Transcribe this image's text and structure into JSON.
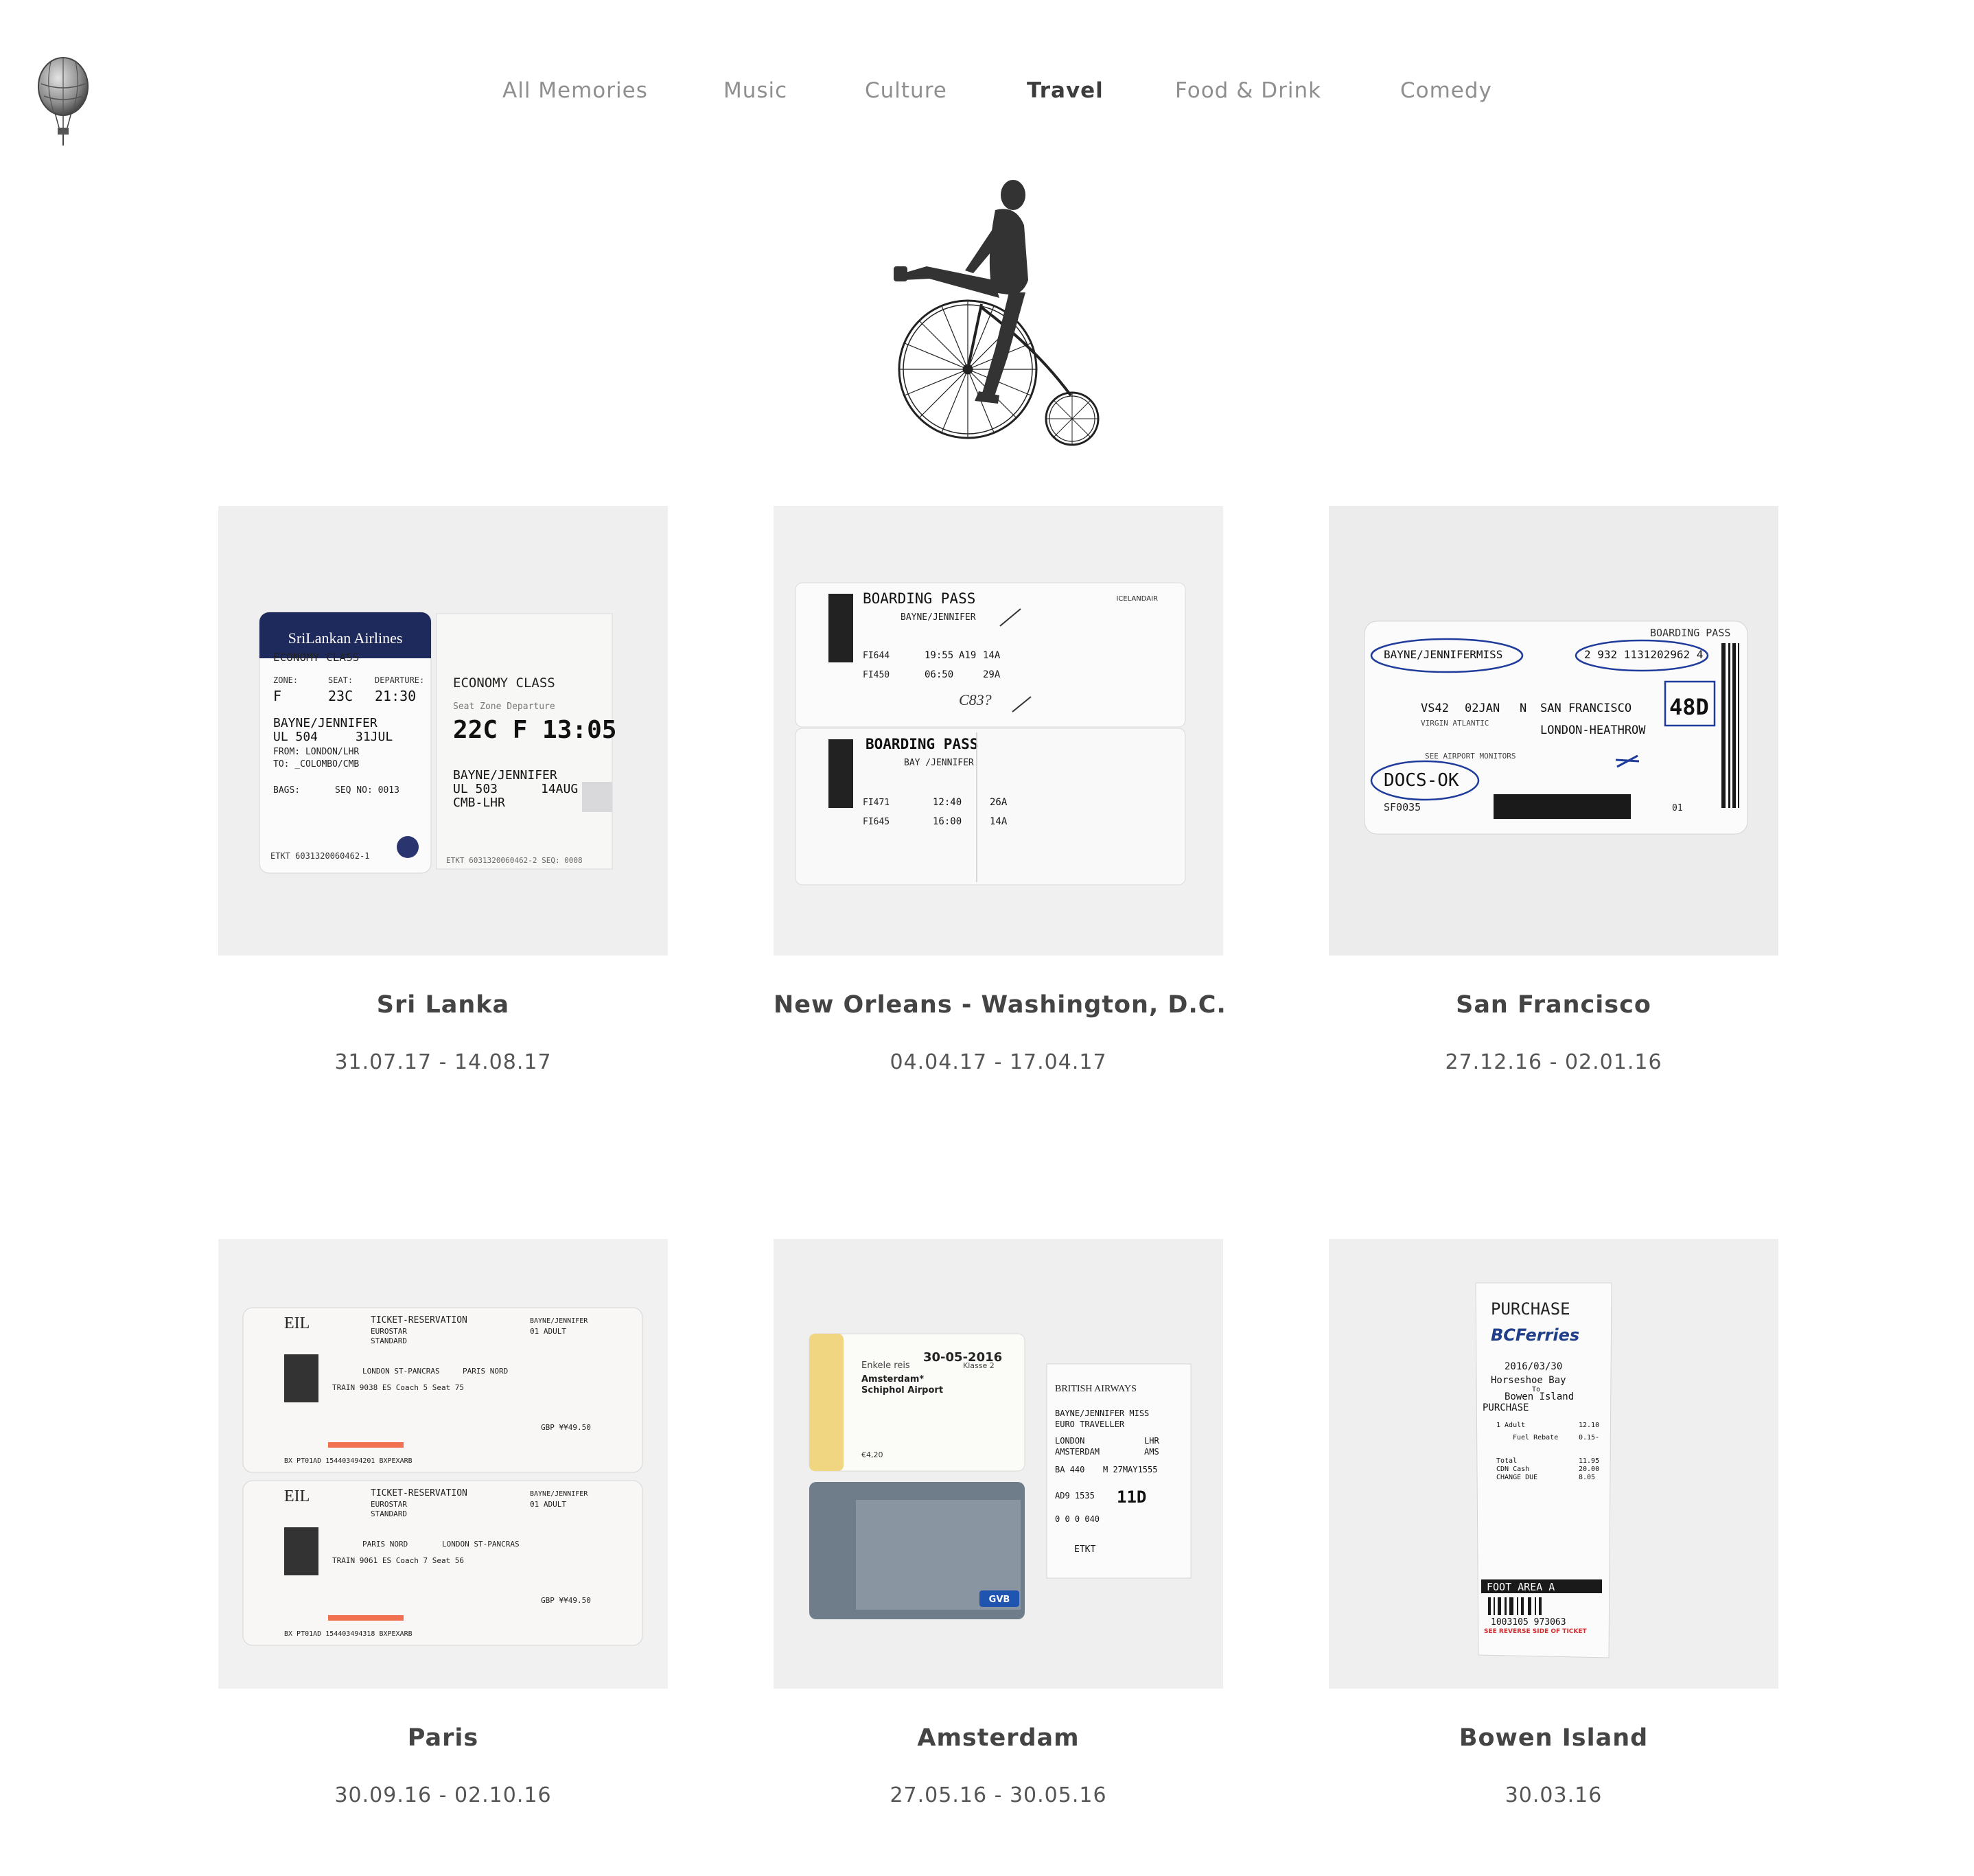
{
  "nav": {
    "items": [
      {
        "label": "All Memories",
        "active": false
      },
      {
        "label": "Music",
        "active": false
      },
      {
        "label": "Culture",
        "active": false
      },
      {
        "label": "Travel",
        "active": true
      },
      {
        "label": "Food & Drink",
        "active": false
      },
      {
        "label": "Comedy",
        "active": false
      }
    ]
  },
  "logo": {
    "icon": "hot-air-balloon-icon"
  },
  "hero": {
    "icon": "penny-farthing-rider-illustration"
  },
  "cards": [
    {
      "title": "Sri Lanka",
      "dates": "31.07.17 - 14.08.17",
      "photo": {
        "airline": "SriLankan Airlines",
        "class_left": "ECONOMY CLASS",
        "zone_lbl": "ZONE:",
        "seat_lbl": "SEAT:",
        "dep_lbl": "DEPARTURE:",
        "zone": "F",
        "seat": "23C",
        "time": "21:30",
        "name": "BAYNE/JENNIFER",
        "flight": "UL 504",
        "date": "31JUL",
        "from": "FROM:  LONDON/LHR",
        "to": "TO:  _COLOMBO/CMB",
        "bags": "BAGS:",
        "seq": "SEQ NO: 0013",
        "etkt": "ETKT 6031320060462-1",
        "class_right": "ECONOMY CLASS",
        "seat_zone_lbl": "Seat   Zone  Departure",
        "big": "22C F 13:05",
        "name2": "BAYNE/JENNIFER",
        "flight2": "UL 503",
        "date2": "14AUG",
        "route2": "CMB-LHR",
        "etkt2": "ETKT 6031320060462-2  SEQ: 0008"
      }
    },
    {
      "title": "New Orleans - Washington, D.C.",
      "dates": "04.04.17 - 17.04.17",
      "photo": {
        "heading": "BOARDING PASS",
        "airline": "ICELANDAIR",
        "name": "BAYNE/JENNIFER",
        "flight_a1": "FI644",
        "time_a1": "19:55",
        "gate_a1": "A19",
        "seat_a1": "14A",
        "flight_a2": "FI450",
        "time_a2": "06:50",
        "seat_a2": "29A",
        "handwritten": "C83?",
        "heading2": "BOARDING PASS",
        "name2": "BAY  /JENNIFER",
        "flight_b1": "FI471",
        "time_b1": "12:40",
        "seat_b1": "26A",
        "flight_b2": "FI645",
        "time_b2": "16:00",
        "seat_b2": "14A"
      }
    },
    {
      "title": "San Francisco",
      "dates": "27.12.16 - 02.01.16",
      "photo": {
        "heading": "BOARDING PASS",
        "name": "BAYNE/JENNIFERMISS",
        "code": "2 932 1131202962 4",
        "flight": "VS42",
        "date": "02JAN",
        "class": "N",
        "origin": "SAN FRANCISCO",
        "destination": "LONDON-HEATHROW",
        "seat": "48D",
        "operated": "VIRGIN ATLANTIC",
        "docs": "DOCS-OK",
        "bcn": "SF0035",
        "bags": "01",
        "monitor": "SEE AIRPORT MONITORS"
      }
    },
    {
      "title": "Paris",
      "dates": "30.09.16 - 02.10.16",
      "photo": {
        "logo": "EIL",
        "heading": "TICKET-RESERVATION",
        "operator": "EUROSTAR",
        "class": "STANDARD",
        "passenger": "BAYNE/JENNIFER",
        "adult": "01 ADULT",
        "route1": "LONDON ST-PANCRAS",
        "dest1": "PARIS NORD",
        "train1": "TRAIN  9038   ES   Coach  5   Seat 75",
        "route2": "PARIS NORD",
        "dest2": "LONDON ST-PANCRAS",
        "train2": "TRAIN  9061   ES   Coach  7   Seat 56",
        "price": "GBP  ¥¥49.50",
        "footer1": "BX PT01AD 154403494201 BXPEXARB",
        "footer2": "BX PT01AD 154403494318 BXPEXARB"
      }
    },
    {
      "title": "Amsterdam",
      "dates": "27.05.16 - 30.05.16",
      "photo": {
        "date": "30-05-2016",
        "trip": "Enkele reis",
        "station": "Amsterdam*",
        "station2": "Schiphol Airport",
        "class": "Klasse 2",
        "price": "€4,20",
        "airline": "BRITISH AIRWAYS",
        "name": "BAYNE/JENNIFER MISS",
        "tier": "EURO TRAVELLER",
        "from": "LONDON",
        "from_code": "LHR",
        "to": "AMSTERDAM",
        "to_code": "AMS",
        "flight": "BA 440",
        "flight_date": "M 27MAY1555",
        "gate": "AD9  1535",
        "seat": "11D",
        "seq": "0 0 0  040",
        "etkt": "ETKT",
        "gvb": "GVB"
      }
    },
    {
      "title": "Bowen Island",
      "dates": "30.03.16",
      "photo": {
        "heading": "PURCHASE",
        "operator": "BCFerries",
        "date": "2016/03/30",
        "route1": "Horseshoe Bay",
        "to": "To",
        "route2": "Bowen Island",
        "kind": "PURCHASE",
        "adult": "1    Adult",
        "adult_price": "12.10",
        "rebate": "Fuel Rebate",
        "rebate_val": "0.15-",
        "total": "Total",
        "total_val": "11.95",
        "cash": "CDN Cash",
        "cash_val": "20.00",
        "change": "CHANGE DUE",
        "change_val": "8.05",
        "foot": "FOOT  AREA A",
        "barcode_num": "1003105 973063",
        "reverse": "SEE REVERSE SIDE OF TICKET"
      }
    }
  ]
}
